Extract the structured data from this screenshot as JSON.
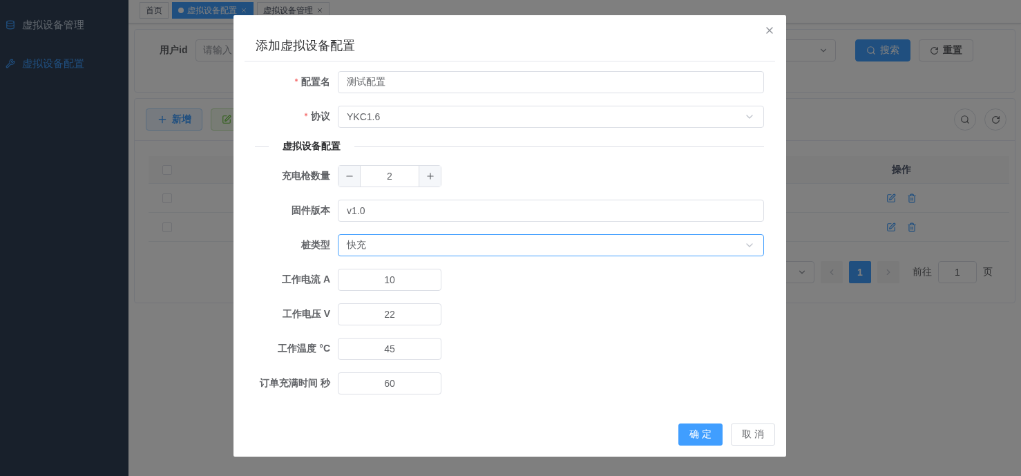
{
  "sidebar": {
    "items": [
      {
        "label": "虚拟设备管理",
        "kind": "database",
        "selected": false
      },
      {
        "label": "虚拟设备配置",
        "kind": "tools",
        "selected": true
      }
    ]
  },
  "tabs": [
    {
      "label": "首页",
      "selected": false,
      "closable": false
    },
    {
      "label": "虚拟设备配置",
      "selected": true,
      "closable": true
    },
    {
      "label": "虚拟设备管理",
      "selected": false,
      "closable": true
    }
  ],
  "search": {
    "label": "用户id",
    "placeholder": "请输入",
    "buttons": [
      {
        "label": "搜索",
        "kind": "primary"
      },
      {
        "label": "重置",
        "kind": "reset"
      }
    ]
  },
  "toolbar": {
    "buttons": [
      {
        "label": "新增",
        "kind": "add"
      },
      {
        "kind": "edit"
      }
    ]
  },
  "table": {
    "header_checked": false,
    "action_column": "操作",
    "rows": [
      {
        "checked": false
      },
      {
        "checked": false
      }
    ]
  },
  "pagination": {
    "current": "1",
    "goto_label": "前往",
    "goto_value": "1",
    "suffix": "页"
  },
  "dialog": {
    "title": "添加虚拟设备配置",
    "fields": [
      {
        "kind": "text",
        "label": "配置名",
        "required": true,
        "value": "测试配置"
      },
      {
        "kind": "select",
        "label": "协议",
        "required": true,
        "value": "YKC1.6",
        "focused": false
      },
      {
        "kind": "section",
        "label": "虚拟设备配置"
      },
      {
        "kind": "stepper",
        "label": "充电枪数量",
        "required": false,
        "value": "2"
      },
      {
        "kind": "text",
        "label": "固件版本",
        "required": false,
        "value": "v1.0"
      },
      {
        "kind": "select",
        "label": "桩类型",
        "required": false,
        "value": "快充",
        "focused": true
      },
      {
        "kind": "number",
        "label": "工作电流 A",
        "required": false,
        "value": "10"
      },
      {
        "kind": "number",
        "label": "工作电压 V",
        "required": false,
        "value": "22"
      },
      {
        "kind": "number",
        "label": "工作温度 °C",
        "required": false,
        "value": "45"
      },
      {
        "kind": "number",
        "label": "订单充满时间 秒",
        "required": false,
        "value": "60"
      }
    ],
    "buttons": [
      {
        "label": "确 定",
        "kind": "primary"
      },
      {
        "label": "取 消",
        "kind": "default"
      }
    ]
  }
}
